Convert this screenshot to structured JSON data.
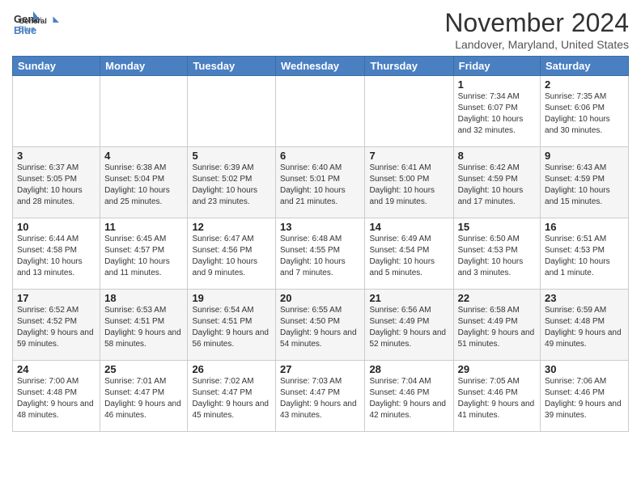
{
  "logo": {
    "line1": "General",
    "line2": "Blue"
  },
  "title": "November 2024",
  "location": "Landover, Maryland, United States",
  "days_of_week": [
    "Sunday",
    "Monday",
    "Tuesday",
    "Wednesday",
    "Thursday",
    "Friday",
    "Saturday"
  ],
  "weeks": [
    [
      {
        "day": "",
        "info": ""
      },
      {
        "day": "",
        "info": ""
      },
      {
        "day": "",
        "info": ""
      },
      {
        "day": "",
        "info": ""
      },
      {
        "day": "",
        "info": ""
      },
      {
        "day": "1",
        "info": "Sunrise: 7:34 AM\nSunset: 6:07 PM\nDaylight: 10 hours and 32 minutes."
      },
      {
        "day": "2",
        "info": "Sunrise: 7:35 AM\nSunset: 6:06 PM\nDaylight: 10 hours and 30 minutes."
      }
    ],
    [
      {
        "day": "3",
        "info": "Sunrise: 6:37 AM\nSunset: 5:05 PM\nDaylight: 10 hours and 28 minutes."
      },
      {
        "day": "4",
        "info": "Sunrise: 6:38 AM\nSunset: 5:04 PM\nDaylight: 10 hours and 25 minutes."
      },
      {
        "day": "5",
        "info": "Sunrise: 6:39 AM\nSunset: 5:02 PM\nDaylight: 10 hours and 23 minutes."
      },
      {
        "day": "6",
        "info": "Sunrise: 6:40 AM\nSunset: 5:01 PM\nDaylight: 10 hours and 21 minutes."
      },
      {
        "day": "7",
        "info": "Sunrise: 6:41 AM\nSunset: 5:00 PM\nDaylight: 10 hours and 19 minutes."
      },
      {
        "day": "8",
        "info": "Sunrise: 6:42 AM\nSunset: 4:59 PM\nDaylight: 10 hours and 17 minutes."
      },
      {
        "day": "9",
        "info": "Sunrise: 6:43 AM\nSunset: 4:59 PM\nDaylight: 10 hours and 15 minutes."
      }
    ],
    [
      {
        "day": "10",
        "info": "Sunrise: 6:44 AM\nSunset: 4:58 PM\nDaylight: 10 hours and 13 minutes."
      },
      {
        "day": "11",
        "info": "Sunrise: 6:45 AM\nSunset: 4:57 PM\nDaylight: 10 hours and 11 minutes."
      },
      {
        "day": "12",
        "info": "Sunrise: 6:47 AM\nSunset: 4:56 PM\nDaylight: 10 hours and 9 minutes."
      },
      {
        "day": "13",
        "info": "Sunrise: 6:48 AM\nSunset: 4:55 PM\nDaylight: 10 hours and 7 minutes."
      },
      {
        "day": "14",
        "info": "Sunrise: 6:49 AM\nSunset: 4:54 PM\nDaylight: 10 hours and 5 minutes."
      },
      {
        "day": "15",
        "info": "Sunrise: 6:50 AM\nSunset: 4:53 PM\nDaylight: 10 hours and 3 minutes."
      },
      {
        "day": "16",
        "info": "Sunrise: 6:51 AM\nSunset: 4:53 PM\nDaylight: 10 hours and 1 minute."
      }
    ],
    [
      {
        "day": "17",
        "info": "Sunrise: 6:52 AM\nSunset: 4:52 PM\nDaylight: 9 hours and 59 minutes."
      },
      {
        "day": "18",
        "info": "Sunrise: 6:53 AM\nSunset: 4:51 PM\nDaylight: 9 hours and 58 minutes."
      },
      {
        "day": "19",
        "info": "Sunrise: 6:54 AM\nSunset: 4:51 PM\nDaylight: 9 hours and 56 minutes."
      },
      {
        "day": "20",
        "info": "Sunrise: 6:55 AM\nSunset: 4:50 PM\nDaylight: 9 hours and 54 minutes."
      },
      {
        "day": "21",
        "info": "Sunrise: 6:56 AM\nSunset: 4:49 PM\nDaylight: 9 hours and 52 minutes."
      },
      {
        "day": "22",
        "info": "Sunrise: 6:58 AM\nSunset: 4:49 PM\nDaylight: 9 hours and 51 minutes."
      },
      {
        "day": "23",
        "info": "Sunrise: 6:59 AM\nSunset: 4:48 PM\nDaylight: 9 hours and 49 minutes."
      }
    ],
    [
      {
        "day": "24",
        "info": "Sunrise: 7:00 AM\nSunset: 4:48 PM\nDaylight: 9 hours and 48 minutes."
      },
      {
        "day": "25",
        "info": "Sunrise: 7:01 AM\nSunset: 4:47 PM\nDaylight: 9 hours and 46 minutes."
      },
      {
        "day": "26",
        "info": "Sunrise: 7:02 AM\nSunset: 4:47 PM\nDaylight: 9 hours and 45 minutes."
      },
      {
        "day": "27",
        "info": "Sunrise: 7:03 AM\nSunset: 4:47 PM\nDaylight: 9 hours and 43 minutes."
      },
      {
        "day": "28",
        "info": "Sunrise: 7:04 AM\nSunset: 4:46 PM\nDaylight: 9 hours and 42 minutes."
      },
      {
        "day": "29",
        "info": "Sunrise: 7:05 AM\nSunset: 4:46 PM\nDaylight: 9 hours and 41 minutes."
      },
      {
        "day": "30",
        "info": "Sunrise: 7:06 AM\nSunset: 4:46 PM\nDaylight: 9 hours and 39 minutes."
      }
    ]
  ]
}
